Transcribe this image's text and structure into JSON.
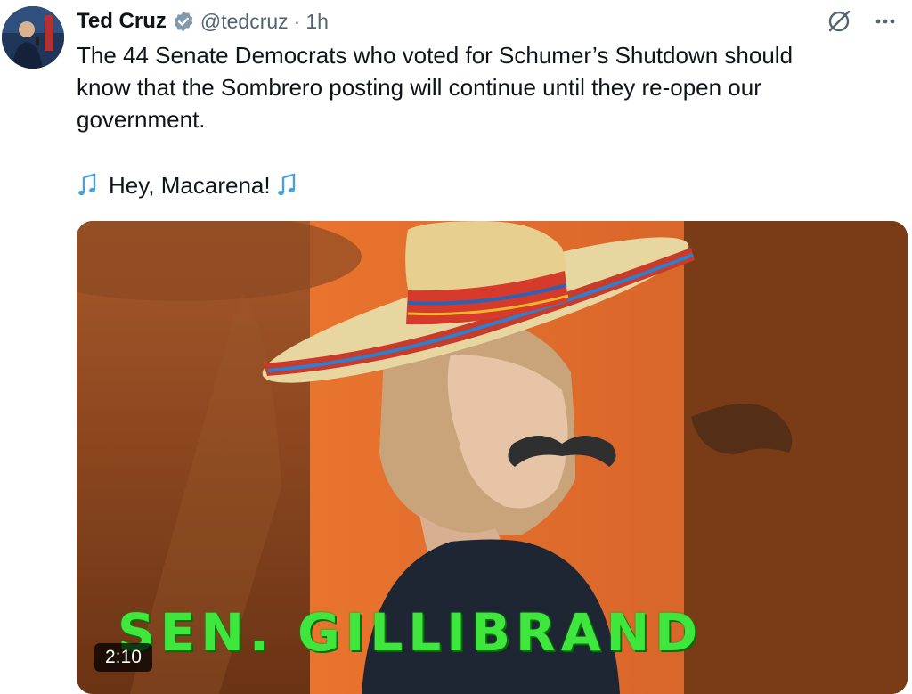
{
  "author": {
    "name": "Ted Cruz",
    "handle": "@tedcruz",
    "separator": "·",
    "time": "1h",
    "verified": true,
    "verified_color": "#829aab"
  },
  "icons": {
    "avatar": "profile-photo",
    "verified": "verified-badge-icon",
    "grok": "grok-icon",
    "more": "more-icon",
    "music": "musical-notes-icon"
  },
  "tweet": {
    "text": "The 44 Senate Democrats who voted for Schumer’s Shutdown should\nknow that the Sombrero posting will continue until they re-open our\ngovernment.",
    "macarena": "Hey, Macarena!"
  },
  "media": {
    "caption": "SEN. GILLIBRAND",
    "duration": "2:10",
    "caption_color": "#3ee63e",
    "background_color": "#e0702a"
  }
}
